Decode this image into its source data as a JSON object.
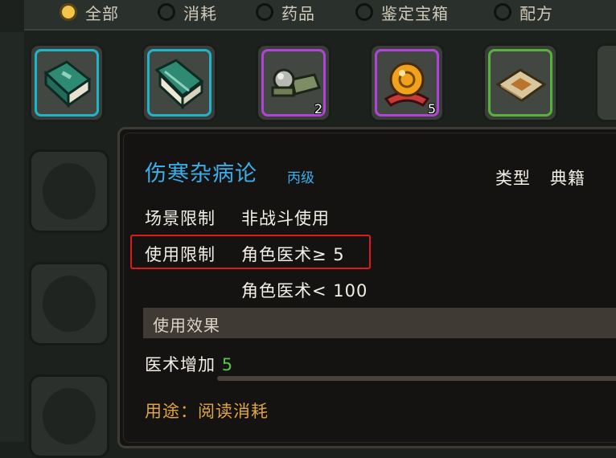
{
  "filters": [
    {
      "label": "全部",
      "selected": true
    },
    {
      "label": "消耗",
      "selected": false
    },
    {
      "label": "药品",
      "selected": false
    },
    {
      "label": "鉴定宝箱",
      "selected": false
    },
    {
      "label": "配方",
      "selected": false
    }
  ],
  "inventory": [
    {
      "icon": "green-book-icon",
      "count": "",
      "rarity": "cyan"
    },
    {
      "icon": "open-book-icon",
      "count": "",
      "rarity": "cyan"
    },
    {
      "icon": "jade-items-icon",
      "count": "2",
      "rarity": "purple"
    },
    {
      "icon": "golden-orb-icon",
      "count": "5",
      "rarity": "purple"
    },
    {
      "icon": "medicine-packet-icon",
      "count": "",
      "rarity": "green"
    }
  ],
  "tooltip": {
    "item_name": "伤寒杂病论",
    "grade": "丙级",
    "type_label": "类型",
    "type_value": "典籍",
    "scene_label": "场景限制",
    "scene_value": "非战斗使用",
    "use_label": "使用限制",
    "requirement_1": "角色医术≥ 5",
    "requirement_2": "角色医术< 100",
    "effect_header": "使用效果",
    "effect_stat": "医术增加",
    "effect_value": "5",
    "usage": "用途：阅读消耗"
  },
  "colors": {
    "title": "#3aaee8",
    "usage": "#e1a53e",
    "effect_value": "#59c24a",
    "highlight": "#e0191b"
  }
}
